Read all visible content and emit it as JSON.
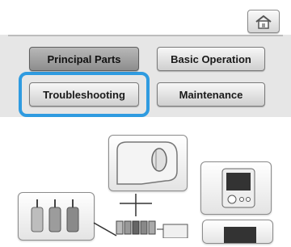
{
  "header": {
    "home_icon": "home-icon"
  },
  "menu": {
    "principal_parts": "Principal Parts",
    "basic_operation": "Basic Operation",
    "troubleshooting": "Troubleshooting",
    "maintenance": "Maintenance",
    "selected": "Troubleshooting"
  },
  "illustration": {
    "icons": [
      "sewing-head-icon",
      "lcd-panel-icon",
      "thread-spools-icon",
      "embroidery-machine-icon"
    ]
  },
  "colors": {
    "highlight": "#2f9be0",
    "band": "#e6e6e6"
  }
}
